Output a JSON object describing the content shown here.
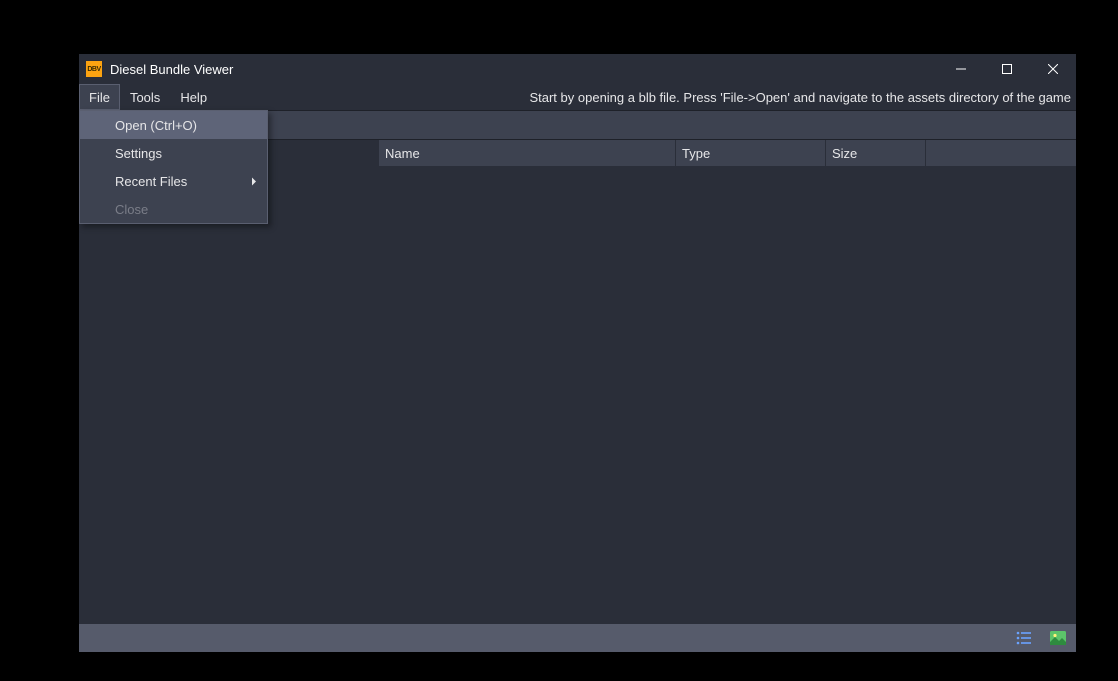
{
  "app": {
    "title": "Diesel Bundle Viewer",
    "icon_label": "DBV"
  },
  "menubar": {
    "file": "File",
    "tools": "Tools",
    "help": "Help"
  },
  "hint": "Start by opening a blb file. Press 'File->Open' and navigate to the assets directory of the game",
  "file_menu": {
    "open": "Open (Ctrl+O)",
    "settings": "Settings",
    "recent": "Recent Files",
    "close": "Close"
  },
  "columns": {
    "name": "Name",
    "type": "Type",
    "size": "Size"
  }
}
